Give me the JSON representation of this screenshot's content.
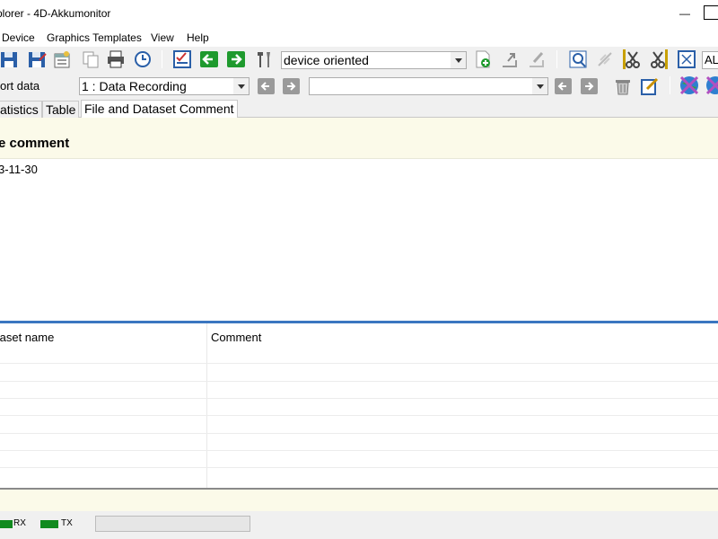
{
  "window": {
    "title": "plorer  -  4D-Akkumonitor",
    "min_glyph": "—"
  },
  "menu": [
    "Device",
    "Graphics Templates",
    "View",
    "Help"
  ],
  "toolbar1": {
    "view_mode": "device oriented",
    "right_label": "AL"
  },
  "toolbar2": {
    "label": "ort data",
    "recording": "1 : Data Recording",
    "dataset": ""
  },
  "tabs": [
    "atistics",
    "Table",
    "File and Dataset Comment"
  ],
  "comment": {
    "heading": "e comment",
    "text": "3-11-30"
  },
  "table": {
    "columns": [
      "taset name",
      "Comment"
    ]
  },
  "status": {
    "rx": "RX",
    "tx": "TX",
    "led_color": "#118a1f"
  },
  "colors": {
    "accent": "#3a76c0",
    "panel": "#fbfae9",
    "toolbar": "#f0f0f0"
  }
}
